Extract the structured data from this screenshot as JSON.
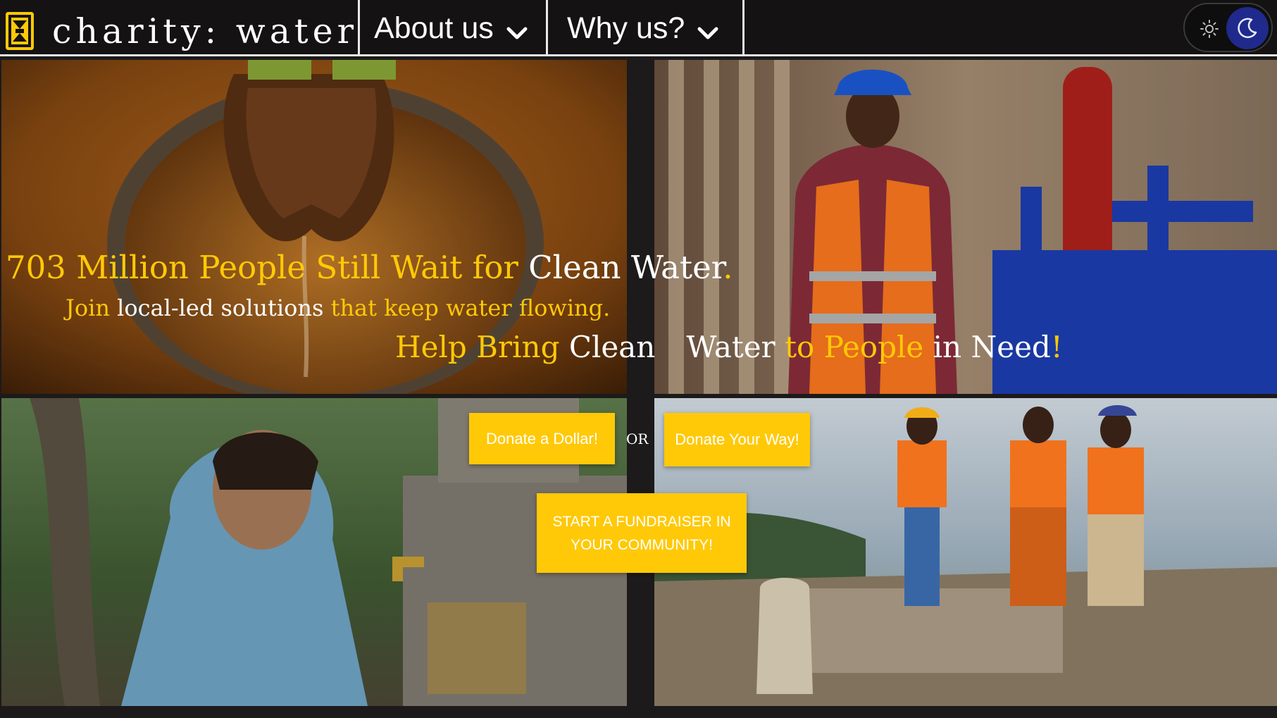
{
  "nav": {
    "brand": "charity: water",
    "menu": [
      {
        "label": "About us"
      },
      {
        "label": "Why us?"
      }
    ],
    "theme_toggle": {
      "light_icon": "sun-icon",
      "dark_icon": "moon-icon",
      "active": "dark"
    }
  },
  "hero": {
    "headline": [
      {
        "text": "703 Million People Still Wait for ",
        "color": "gold"
      },
      {
        "text": "Clean Water",
        "color": "white"
      },
      {
        "text": ".",
        "color": "gold"
      }
    ],
    "subline": [
      {
        "text": "Join ",
        "color": "gold"
      },
      {
        "text": "local-led solutions ",
        "color": "white"
      },
      {
        "text": "that keep water flowing.",
        "color": "gold"
      }
    ],
    "helpline": [
      {
        "text": "Help Bring ",
        "color": "gold"
      },
      {
        "text": "Clean",
        "color": "white"
      },
      {
        "text": "Water ",
        "color": "white"
      },
      {
        "text": "to People ",
        "color": "gold"
      },
      {
        "text": "in Need",
        "color": "white"
      },
      {
        "text": "!",
        "color": "gold"
      }
    ]
  },
  "cta": {
    "donate_dollar": "Donate a Dollar!",
    "or": "OR",
    "donate_way": "Donate Your Way!",
    "fundraiser": "START A FUNDRAISER IN YOUR COMMUNITY!"
  },
  "colors": {
    "brand_yellow": "#ffc907",
    "nav_bg": "#141212",
    "page_bg": "#1c1a1a",
    "moon_bg": "#1f2a8c"
  },
  "images": [
    {
      "name": "cupped-hands-water-photo"
    },
    {
      "name": "engineer-hardhat-pump-photo"
    },
    {
      "name": "girl-washing-face-tap-photo"
    },
    {
      "name": "workers-at-well-site-photo"
    }
  ]
}
